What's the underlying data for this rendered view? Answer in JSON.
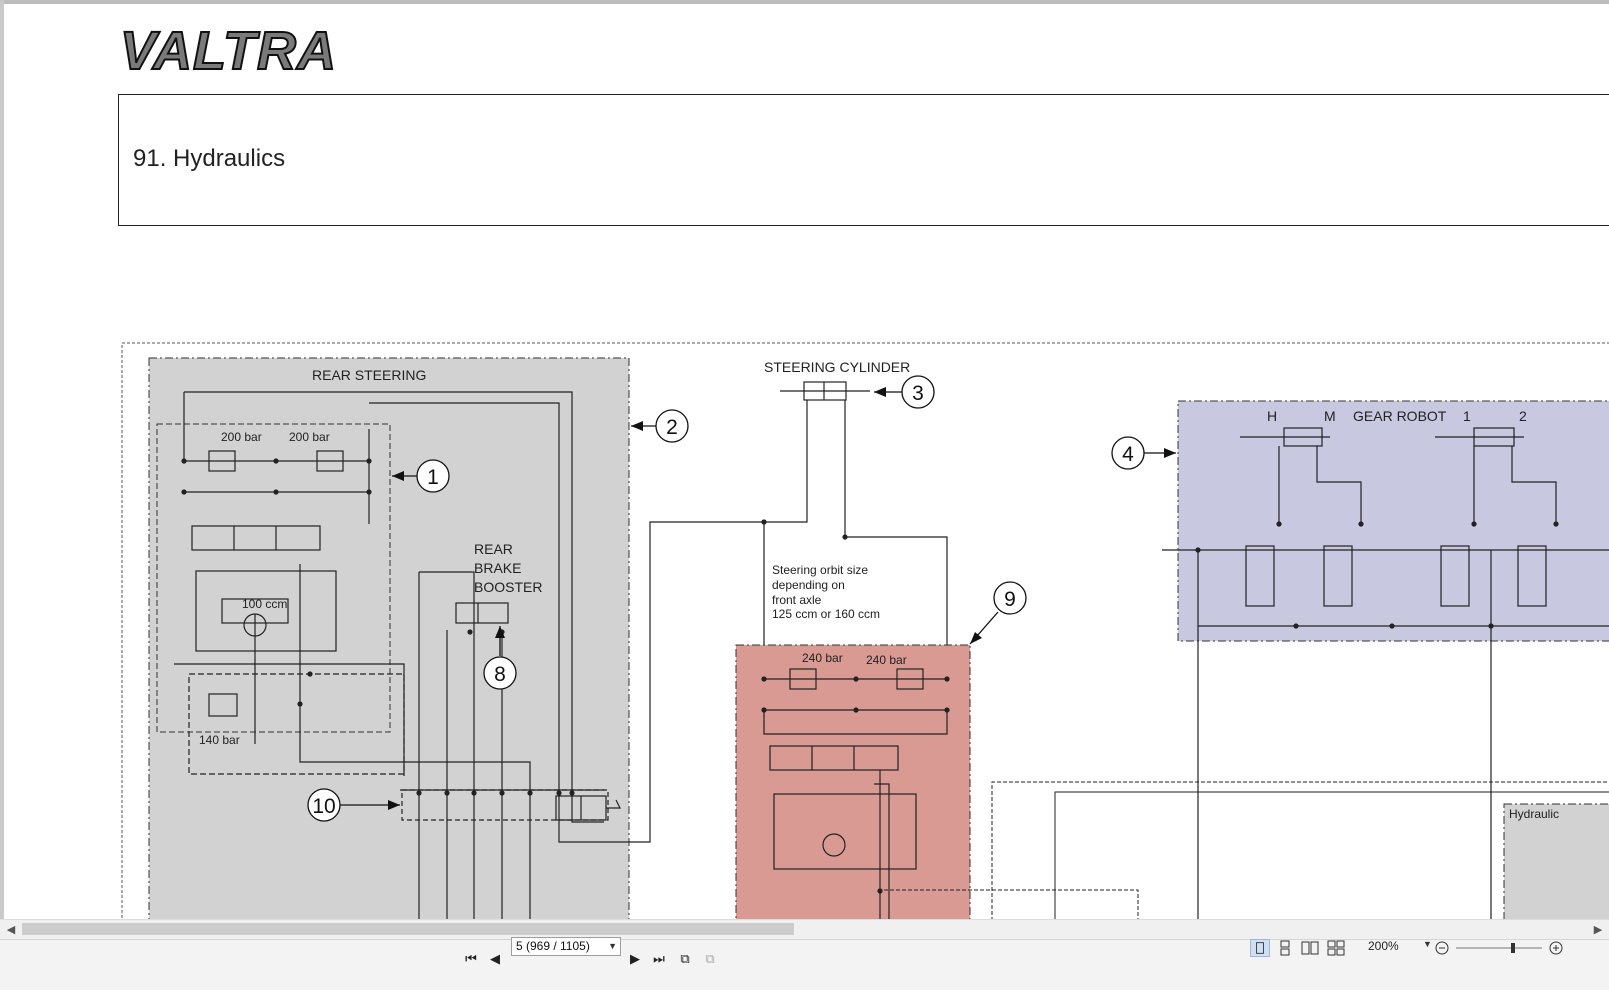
{
  "document": {
    "brand": "VALTRA",
    "section_title": "91. Hydraulics"
  },
  "schematic": {
    "rear_steering_label": "REAR STEERING",
    "steering_cylinder_label": "STEERING CYLINDER",
    "gear_robot_label": "GEAR ROBOT",
    "gear_robot_h": "H",
    "gear_robot_m": "M",
    "gear_robot_1": "1",
    "gear_robot_2": "2",
    "rear_brake_booster": [
      "REAR",
      "BRAKE",
      "BOOSTER"
    ],
    "orbit_note": [
      "Steering orbit size",
      "depending on",
      "front axle",
      "125 ccm or 160 ccm"
    ],
    "pressures": {
      "rs_left": "200 bar",
      "rs_right": "200 bar",
      "rs_low": "140 bar",
      "front_left": "240 bar",
      "front_right": "240 bar"
    },
    "rs_orbit": "100 ccm",
    "hydraulic_partial": "Hydraulic",
    "callouts": [
      "1",
      "2",
      "3",
      "4",
      "8",
      "9",
      "10"
    ],
    "colors": {
      "rear_steering_fill": "#d2d2d2",
      "gear_robot_fill": "#c8c8e0",
      "front_steering_fill": "#d99a94",
      "line": "#222222"
    }
  },
  "toolbar": {
    "page_indicator": "5 (969 / 1105)",
    "zoom": "200%"
  }
}
